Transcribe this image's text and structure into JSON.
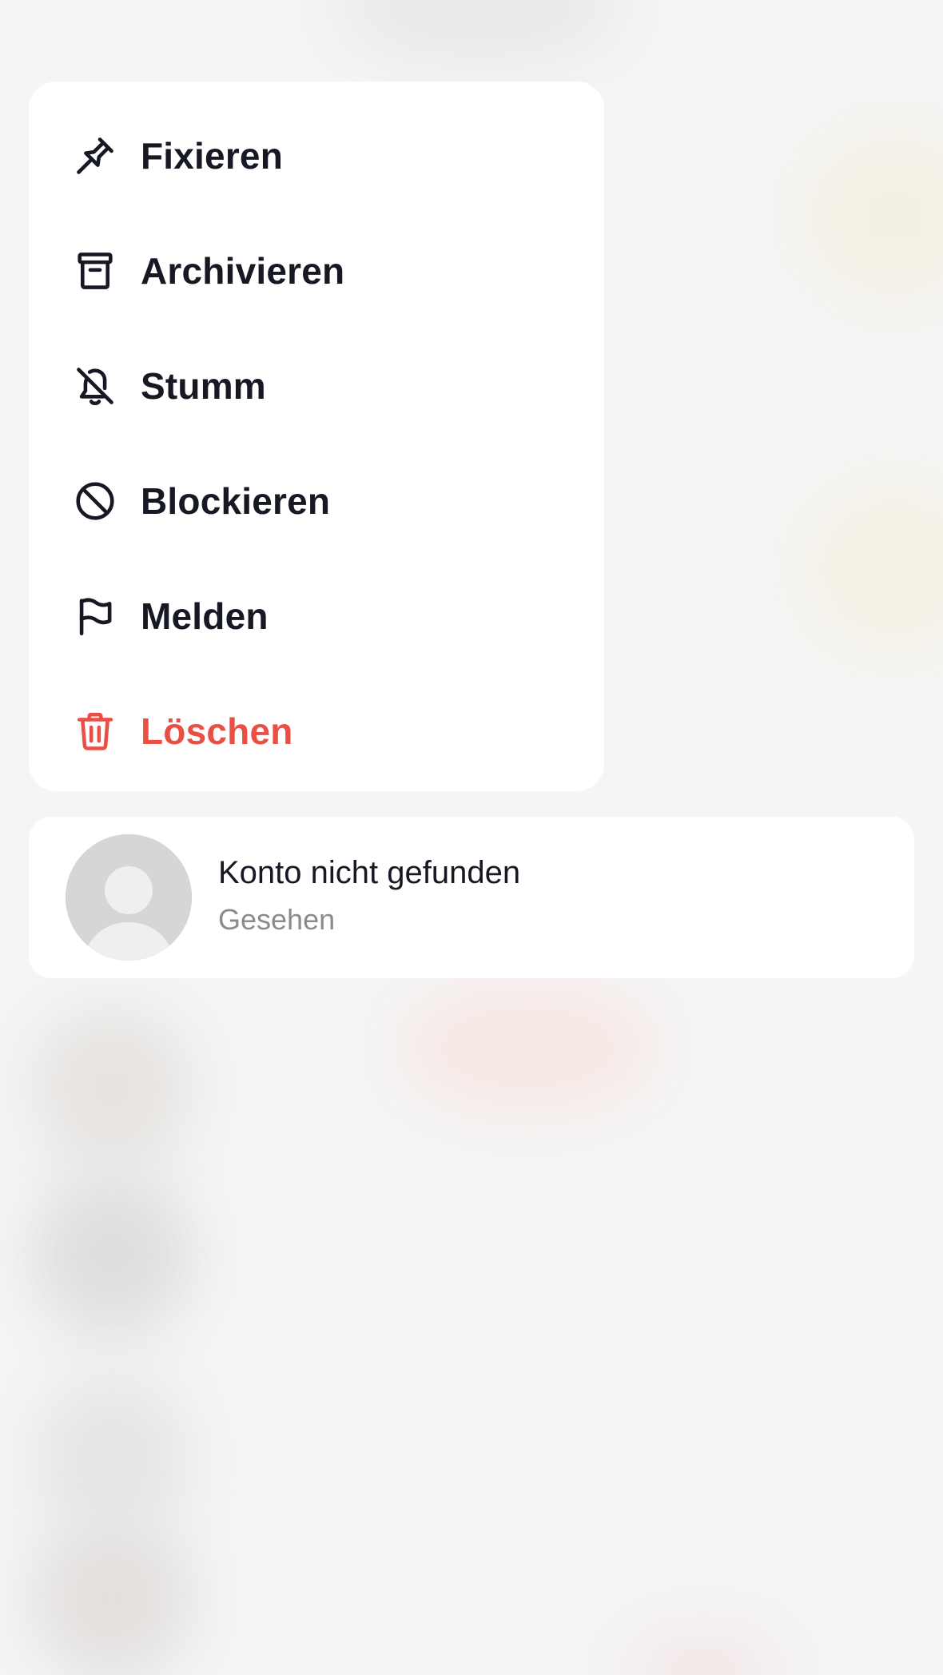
{
  "colors": {
    "danger": "#ea4f45",
    "text": "#161823",
    "secondary_text": "#8a8b91"
  },
  "menu": {
    "items": [
      {
        "label": "Fixieren",
        "icon": "pin-icon"
      },
      {
        "label": "Archivieren",
        "icon": "archive-icon"
      },
      {
        "label": "Stumm",
        "icon": "bell-off-icon"
      },
      {
        "label": "Blockieren",
        "icon": "block-icon"
      },
      {
        "label": "Melden",
        "icon": "flag-icon"
      },
      {
        "label": "Löschen",
        "icon": "trash-icon"
      }
    ]
  },
  "chat": {
    "name": "Konto nicht gefunden",
    "status": "Gesehen",
    "avatar_icon": "default-avatar-icon"
  }
}
